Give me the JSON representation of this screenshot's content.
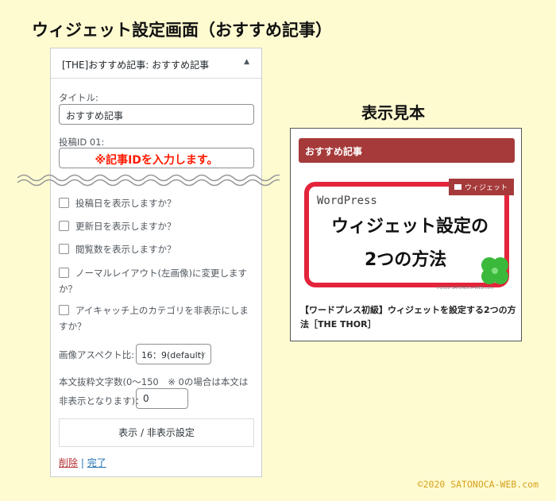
{
  "headings": {
    "main": "ウィジェット設定画面（おすすめ記事）",
    "sample": "表示見本"
  },
  "widget": {
    "header_title": "[THE]おすすめ記事: おすすめ記事",
    "collapse_icon": "triangle-up-icon",
    "title_label": "タイトル:",
    "title_value": "おすすめ記事",
    "post_id_label": "投稿ID 01:",
    "post_id_note": "※記事IDを入力します。",
    "options": [
      "投稿日を表示しますか？",
      "更新日を表示しますか？",
      "閲覧数を表示しますか？",
      "ノーマルレイアウト(左画像)に変更しますか？",
      "アイキャッチ上のカテゴリを非表示にしますか？"
    ],
    "aspect_label": "画像アスペクト比:",
    "aspect_value": "16：9(default)",
    "excerpt_label": "本文抜粋文字数(0〜150　※ 0の場合は本文は非表示となります)：",
    "excerpt_value": "0",
    "toggle_button": "表示 / 非表示設定",
    "delete_link": "削除",
    "separator": "|",
    "done_link": "完了"
  },
  "sample": {
    "bar_title": "おすすめ記事",
    "category_tag": "ウィジェット",
    "category_icon": "folder-icon",
    "thumb_small": "WordPress",
    "thumb_line1": "ウィジェット設定の",
    "thumb_line2": "2つの方法",
    "thumb_credit": "©2020 SATONOCA-WEB.com",
    "post_title": "【ワードプレス初級】ウィジェットを設定する2つの方法［THE THOR］"
  },
  "copyright": "©2020 SATONOCA-WEB.com",
  "colors": {
    "background": "#fffbd1",
    "accent_red": "#a63a3a",
    "note_red": "#ff1a00",
    "frame_red": "#e3243b",
    "copyright_gold": "#d6a21e"
  }
}
